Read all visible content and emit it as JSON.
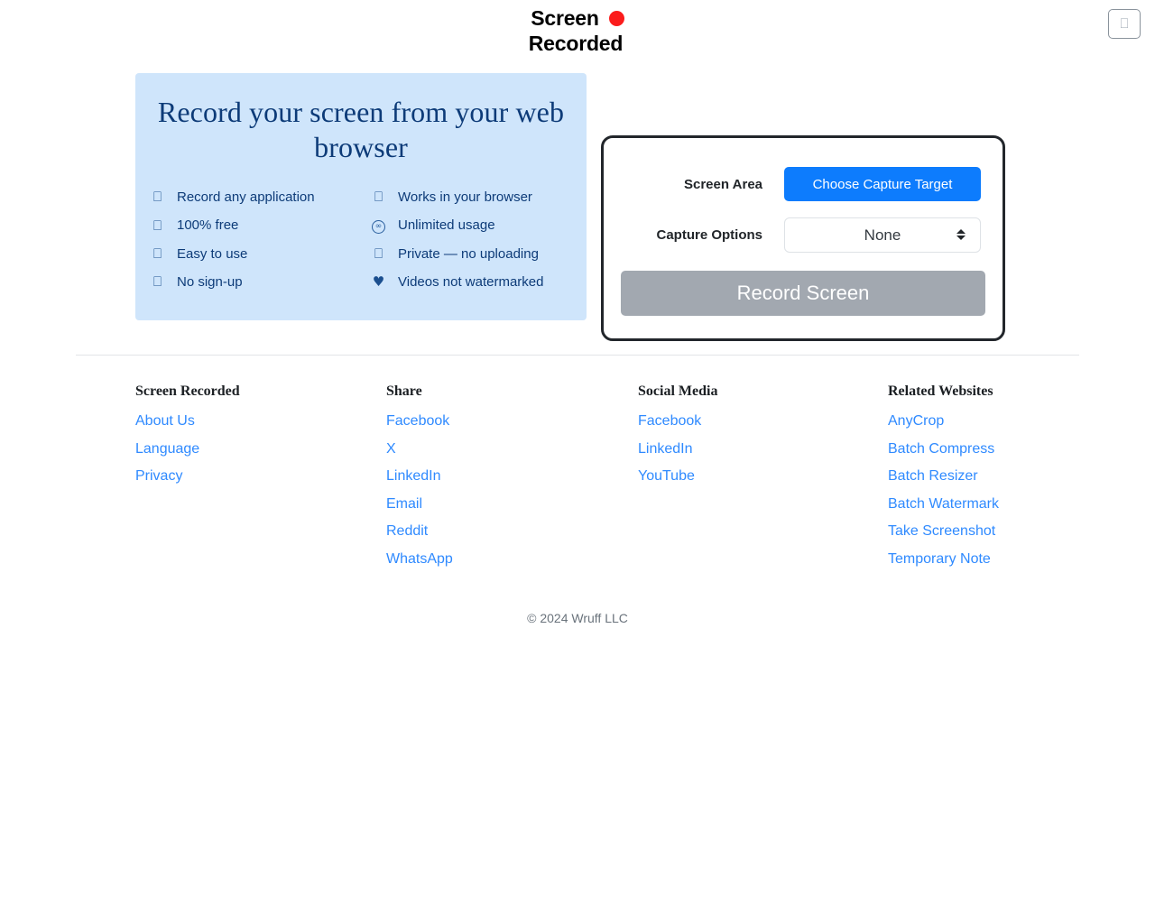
{
  "header": {
    "logo_line1": "Screen",
    "logo_line2": "Recorded",
    "logo_dot_color": "#fb1c1c",
    "menu_button_icon": "hamburger-menu-icon",
    "menu_button_glyph": "⎕"
  },
  "promo": {
    "heading": "Record your screen from your web browser",
    "background_color": "#cfe5fb",
    "text_color": "#0d3b78",
    "features": [
      {
        "label": "Record any application",
        "icon": "missing-glyph-icon",
        "glyph": "⎕"
      },
      {
        "label": "Works in your browser",
        "icon": "missing-glyph-icon",
        "glyph": "⎕"
      },
      {
        "label": "100% free",
        "icon": "missing-glyph-icon",
        "glyph": "⎕"
      },
      {
        "label": "Unlimited usage",
        "icon": "infinity-icon",
        "glyph": "∞"
      },
      {
        "label": "Easy to use",
        "icon": "missing-glyph-icon",
        "glyph": "⎕"
      },
      {
        "label": "Private — no uploading",
        "icon": "missing-glyph-icon",
        "glyph": "⎕"
      },
      {
        "label": "No sign-up",
        "icon": "missing-glyph-icon",
        "glyph": "⎕"
      },
      {
        "label": "Videos not watermarked",
        "icon": "heart-icon",
        "glyph": "♥"
      }
    ]
  },
  "recorder": {
    "screen_area_label": "Screen Area",
    "choose_target_button": "Choose Capture Target",
    "capture_options_label": "Capture Options",
    "capture_options_value": "None",
    "capture_options_items": [
      "None"
    ],
    "record_button": "Record Screen",
    "record_button_enabled": false,
    "accent_color": "#0d7cfd",
    "disabled_color": "#a2a8b0",
    "border_color": "#22262b"
  },
  "footer": {
    "columns": [
      {
        "title": "Screen Recorded",
        "links": [
          "About Us",
          "Language",
          "Privacy"
        ]
      },
      {
        "title": "Share",
        "links": [
          "Facebook",
          "X",
          "LinkedIn",
          "Email",
          "Reddit",
          "WhatsApp"
        ]
      },
      {
        "title": "Social Media",
        "links": [
          "Facebook",
          "LinkedIn",
          "YouTube"
        ]
      },
      {
        "title": "Related Websites",
        "links": [
          "AnyCrop",
          "Batch Compress",
          "Batch Resizer",
          "Batch Watermark",
          "Take Screenshot",
          "Temporary Note"
        ]
      }
    ],
    "copyright": "© 2024 Wruff LLC",
    "link_color": "#2f8aff"
  }
}
